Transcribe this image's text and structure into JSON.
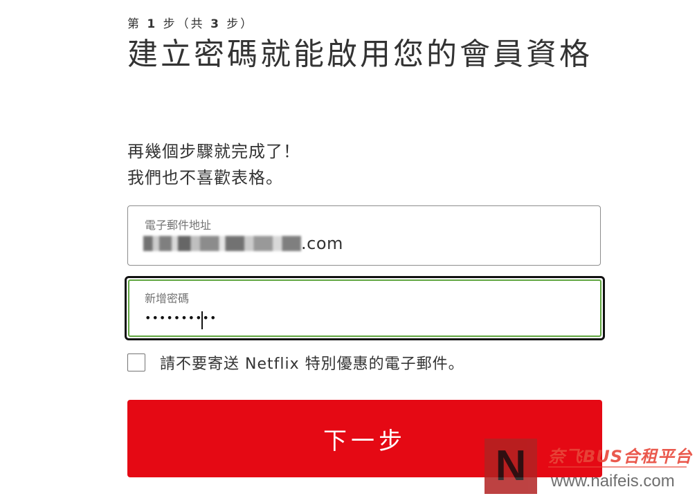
{
  "step": {
    "prefix": "第 ",
    "current": "1",
    "middle": " 步（共 ",
    "total": "3",
    "suffix": " 步）"
  },
  "title": "建立密碼就能啟用您的會員資格",
  "subtitle": {
    "line1": "再幾個步驟就完成了！",
    "line2": "我們也不喜歡表格。"
  },
  "email_field": {
    "label": "電子郵件地址",
    "value_suffix": ".com"
  },
  "password_field": {
    "label": "新增密碼",
    "value": "••••••••••"
  },
  "opt_out": {
    "label": "請不要寄送 Netflix 特別優惠的電子郵件。",
    "checked": false
  },
  "next_button": {
    "label": "下一步"
  },
  "watermark": {
    "logo": "N",
    "brand": "奈飞BUS合租平台",
    "url": "www.naifeis.com"
  },
  "colors": {
    "accent": "#e50914",
    "focus_ring": "#5fa53f"
  }
}
